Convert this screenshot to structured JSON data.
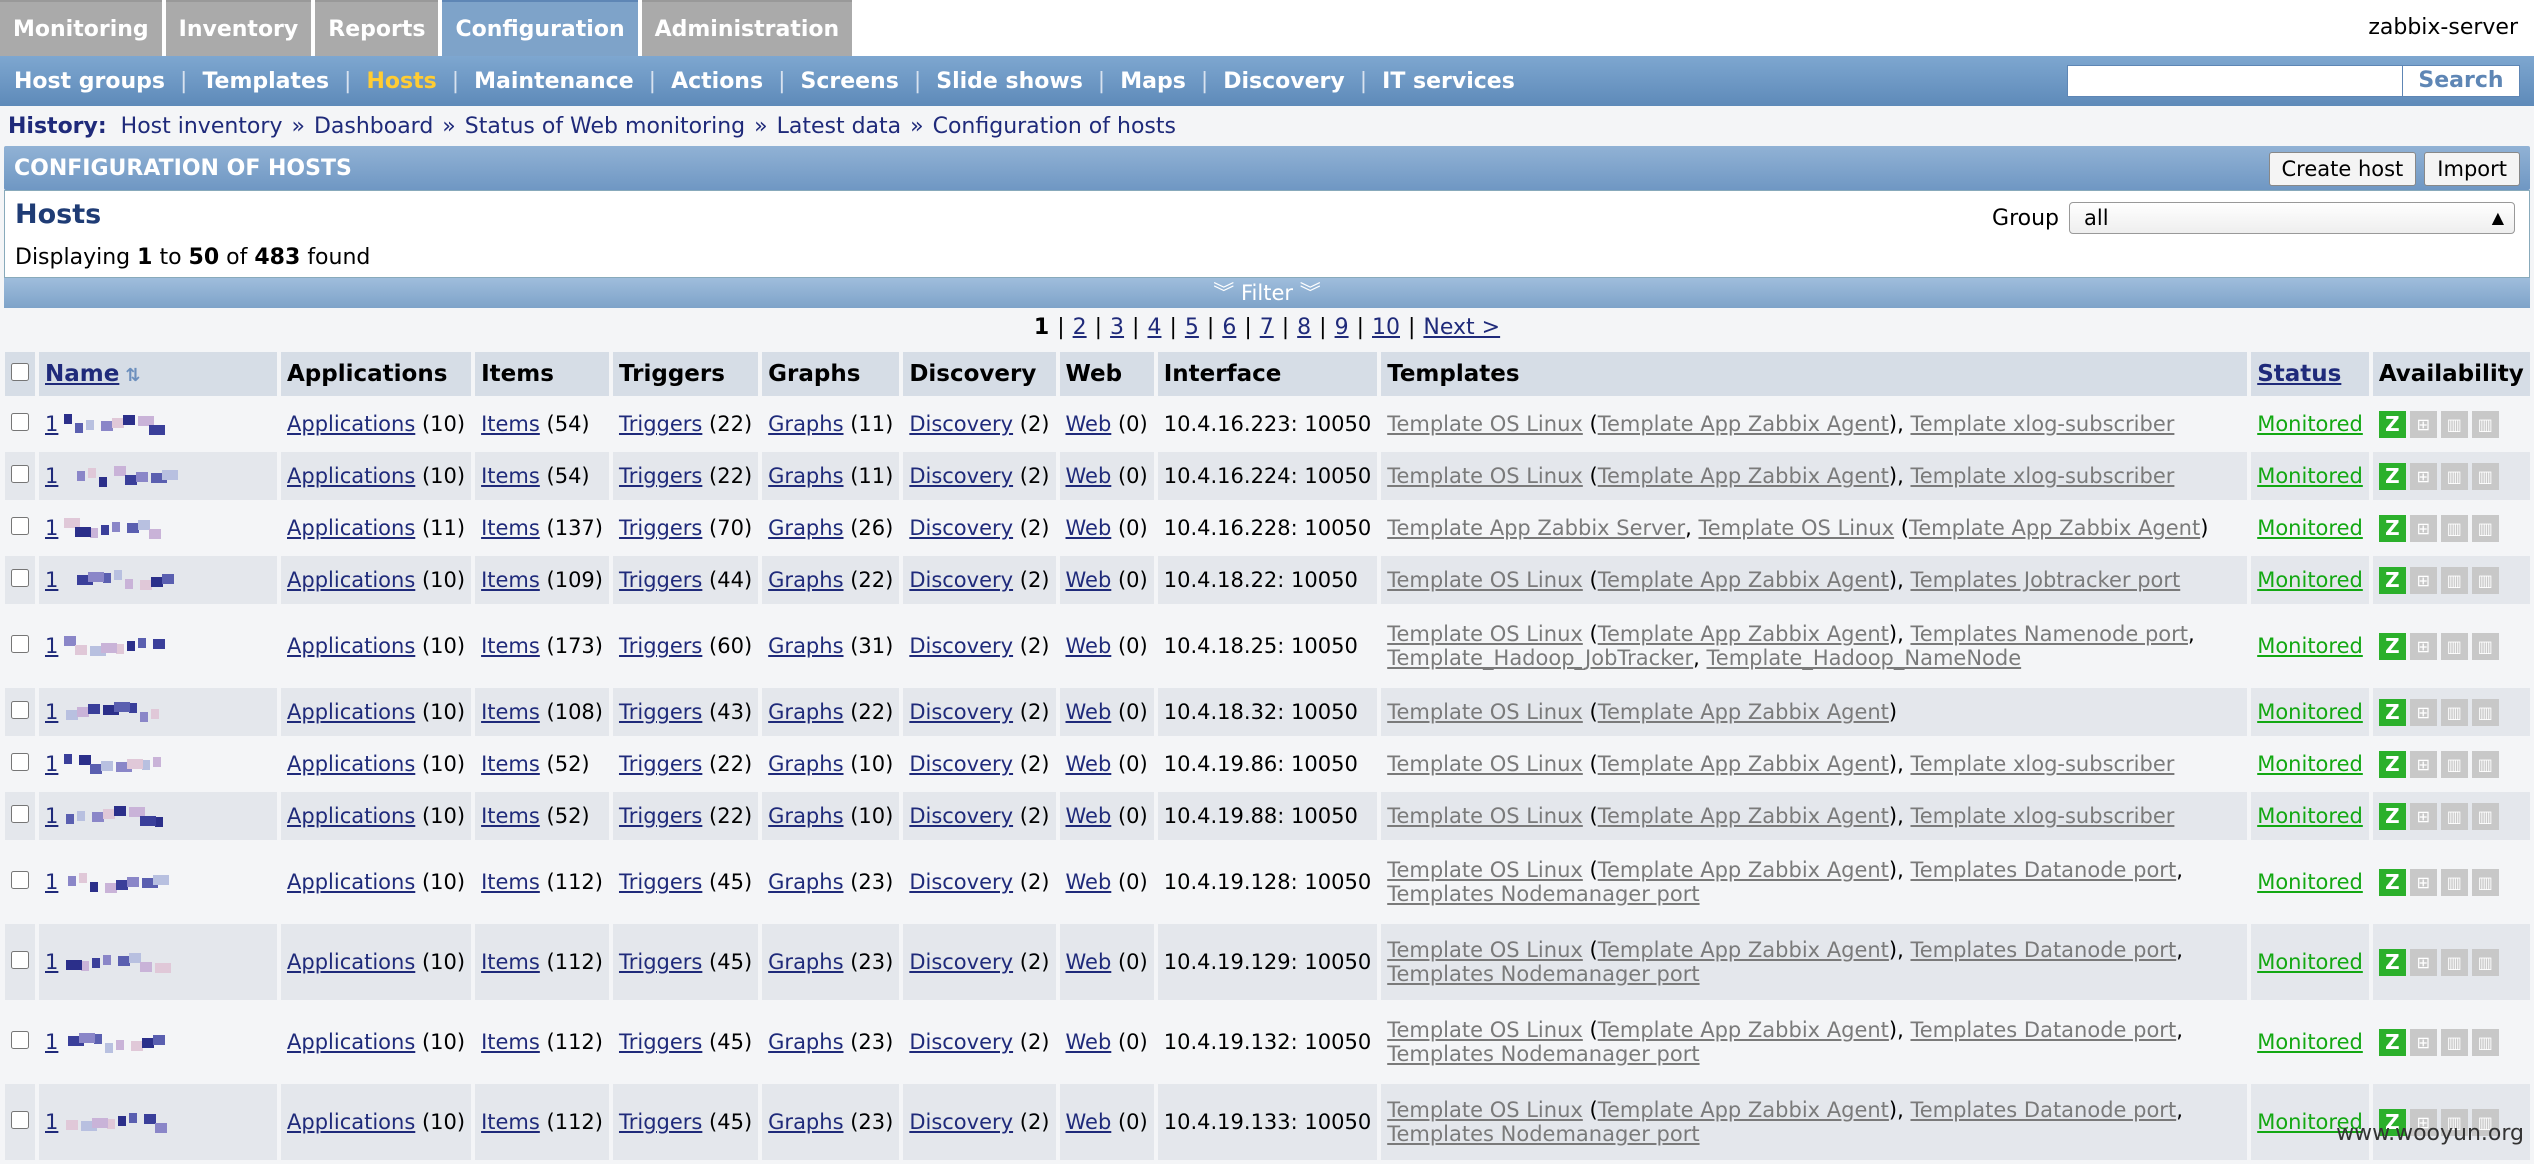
{
  "main_tabs": [
    {
      "label": "Monitoring",
      "active": false
    },
    {
      "label": "Inventory",
      "active": false
    },
    {
      "label": "Reports",
      "active": false
    },
    {
      "label": "Configuration",
      "active": true
    },
    {
      "label": "Administration",
      "active": false
    }
  ],
  "server_name": "zabbix-server",
  "sub_menu": [
    {
      "label": "Host groups",
      "active": false
    },
    {
      "label": "Templates",
      "active": false
    },
    {
      "label": "Hosts",
      "active": true
    },
    {
      "label": "Maintenance",
      "active": false
    },
    {
      "label": "Actions",
      "active": false
    },
    {
      "label": "Screens",
      "active": false
    },
    {
      "label": "Slide shows",
      "active": false
    },
    {
      "label": "Maps",
      "active": false
    },
    {
      "label": "Discovery",
      "active": false
    },
    {
      "label": "IT services",
      "active": false
    }
  ],
  "search": {
    "value": "",
    "button": "Search"
  },
  "history": {
    "label": "History:",
    "links": [
      "Host inventory",
      "Dashboard",
      "Status of Web monitoring",
      "Latest data",
      "Configuration of hosts"
    ],
    "separator": "»"
  },
  "header": {
    "title": "CONFIGURATION OF HOSTS",
    "create_button": "Create host",
    "import_button": "Import"
  },
  "hosts_box": {
    "title": "Hosts",
    "displaying": {
      "prefix": "Displaying",
      "from": "1",
      "to_word": "to",
      "to": "50",
      "of_word": "of",
      "total": "483",
      "suffix": "found"
    },
    "group_label": "Group",
    "group_value": "all"
  },
  "filter_label": "Filter",
  "pager": {
    "pages": [
      "1",
      "2",
      "3",
      "4",
      "5",
      "6",
      "7",
      "8",
      "9",
      "10"
    ],
    "current": "1",
    "next": "Next >"
  },
  "columns": [
    "Name",
    "Applications",
    "Items",
    "Triggers",
    "Graphs",
    "Discovery",
    "Web",
    "Interface",
    "Templates",
    "Status",
    "Availability"
  ],
  "rows": [
    {
      "name": "1",
      "apps": "(10)",
      "items": "(54)",
      "triggers": "(22)",
      "graphs": "(11)",
      "discovery": "(2)",
      "web": "(0)",
      "interface": "10.4.16.223: 10050",
      "templates": [
        "Template OS Linux",
        " (",
        "Template App Zabbix Agent",
        "), ",
        "Template xlog-subscriber"
      ],
      "status": "Monitored"
    },
    {
      "name": "1",
      "apps": "(10)",
      "items": "(54)",
      "triggers": "(22)",
      "graphs": "(11)",
      "discovery": "(2)",
      "web": "(0)",
      "interface": "10.4.16.224: 10050",
      "templates": [
        "Template OS Linux",
        " (",
        "Template App Zabbix Agent",
        "), ",
        "Template xlog-subscriber"
      ],
      "status": "Monitored"
    },
    {
      "name": "1",
      "apps": "(11)",
      "items": "(137)",
      "triggers": "(70)",
      "graphs": "(26)",
      "discovery": "(2)",
      "web": "(0)",
      "interface": "10.4.16.228: 10050",
      "templates": [
        "Template App Zabbix Server",
        ", ",
        "Template OS Linux",
        " (",
        "Template App Zabbix Agent",
        ")"
      ],
      "status": "Monitored"
    },
    {
      "name": "1",
      "apps": "(10)",
      "items": "(109)",
      "triggers": "(44)",
      "graphs": "(22)",
      "discovery": "(2)",
      "web": "(0)",
      "interface": "10.4.18.22: 10050",
      "templates": [
        "Template OS Linux",
        " (",
        "Template App Zabbix Agent",
        "), ",
        "Templates Jobtracker port"
      ],
      "status": "Monitored"
    },
    {
      "name": "1",
      "apps": "(10)",
      "items": "(173)",
      "triggers": "(60)",
      "graphs": "(31)",
      "discovery": "(2)",
      "web": "(0)",
      "interface": "10.4.18.25: 10050",
      "templates": [
        "Template OS Linux",
        " (",
        "Template App Zabbix Agent",
        "), ",
        "Templates Namenode port",
        ",",
        "\n",
        "Template_Hadoop_JobTracker",
        ", ",
        "Template_Hadoop_NameNode"
      ],
      "status": "Monitored"
    },
    {
      "name": "1",
      "apps": "(10)",
      "items": "(108)",
      "triggers": "(43)",
      "graphs": "(22)",
      "discovery": "(2)",
      "web": "(0)",
      "interface": "10.4.18.32: 10050",
      "templates": [
        "Template OS Linux",
        " (",
        "Template App Zabbix Agent",
        ")"
      ],
      "status": "Monitored"
    },
    {
      "name": "1",
      "apps": "(10)",
      "items": "(52)",
      "triggers": "(22)",
      "graphs": "(10)",
      "discovery": "(2)",
      "web": "(0)",
      "interface": "10.4.19.86: 10050",
      "templates": [
        "Template OS Linux",
        " (",
        "Template App Zabbix Agent",
        "), ",
        "Template xlog-subscriber"
      ],
      "status": "Monitored"
    },
    {
      "name": "1",
      "apps": "(10)",
      "items": "(52)",
      "triggers": "(22)",
      "graphs": "(10)",
      "discovery": "(2)",
      "web": "(0)",
      "interface": "10.4.19.88: 10050",
      "templates": [
        "Template OS Linux",
        " (",
        "Template App Zabbix Agent",
        "), ",
        "Template xlog-subscriber"
      ],
      "status": "Monitored"
    },
    {
      "name": "1",
      "apps": "(10)",
      "items": "(112)",
      "triggers": "(45)",
      "graphs": "(23)",
      "discovery": "(2)",
      "web": "(0)",
      "interface": "10.4.19.128: 10050",
      "templates": [
        "Template OS Linux",
        " (",
        "Template App Zabbix Agent",
        "), ",
        "Templates Datanode port",
        ",",
        "\n",
        "Templates Nodemanager port"
      ],
      "status": "Monitored"
    },
    {
      "name": "1",
      "apps": "(10)",
      "items": "(112)",
      "triggers": "(45)",
      "graphs": "(23)",
      "discovery": "(2)",
      "web": "(0)",
      "interface": "10.4.19.129: 10050",
      "templates": [
        "Template OS Linux",
        " (",
        "Template App Zabbix Agent",
        "), ",
        "Templates Datanode port",
        ",",
        "\n",
        "Templates Nodemanager port"
      ],
      "status": "Monitored"
    },
    {
      "name": "1",
      "apps": "(10)",
      "items": "(112)",
      "triggers": "(45)",
      "graphs": "(23)",
      "discovery": "(2)",
      "web": "(0)",
      "interface": "10.4.19.132: 10050",
      "templates": [
        "Template OS Linux",
        " (",
        "Template App Zabbix Agent",
        "), ",
        "Templates Datanode port",
        ",",
        "\n",
        "Templates Nodemanager port"
      ],
      "status": "Monitored"
    },
    {
      "name": "1",
      "apps": "(10)",
      "items": "(112)",
      "triggers": "(45)",
      "graphs": "(23)",
      "discovery": "(2)",
      "web": "(0)",
      "interface": "10.4.19.133: 10050",
      "templates": [
        "Template OS Linux",
        " (",
        "Template App Zabbix Agent",
        "), ",
        "Templates Datanode port",
        ",",
        "\n",
        "Templates Nodemanager port"
      ],
      "status": "Monitored"
    }
  ],
  "link_words": {
    "applications": "Applications",
    "items": "Items",
    "triggers": "Triggers",
    "graphs": "Graphs",
    "discovery": "Discovery",
    "web": "Web"
  },
  "availability_icons": [
    "zabbix-agent-icon",
    "snmp-icon",
    "jmx-icon",
    "ipmi-icon"
  ],
  "availability_z_label": "Z",
  "watermark": "www.wooyun.org",
  "colors": {
    "monitored": "#13a813",
    "active_sub": "#ffcc33",
    "header_blue": "#6f97c3"
  }
}
